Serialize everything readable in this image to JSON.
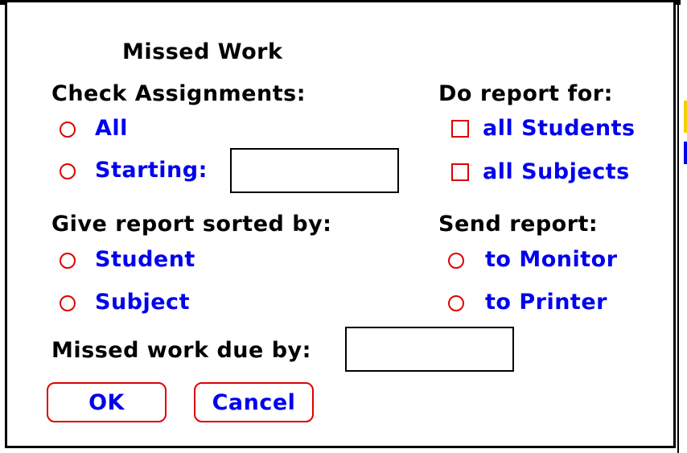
{
  "dialog": {
    "title": "Missed Work",
    "check_assignments": {
      "label": "Check Assignments:",
      "option_all": "All",
      "option_starting": "Starting:",
      "starting_value": ""
    },
    "report_for": {
      "label": "Do report for:",
      "option_students": "all Students",
      "option_subjects": "all Subjects"
    },
    "sorted_by": {
      "label": "Give report sorted by:",
      "option_student": "Student",
      "option_subject": "Subject"
    },
    "send_report": {
      "label": "Send report:",
      "option_monitor": "to Monitor",
      "option_printer": "to Printer"
    },
    "due_by": {
      "label": "Missed work due by:",
      "value": ""
    },
    "buttons": {
      "ok": "OK",
      "cancel": "Cancel"
    }
  },
  "colors": {
    "control_outline": "#e00000",
    "option_text": "#0000ee",
    "label_text": "#000000",
    "background": "#ffffff"
  }
}
